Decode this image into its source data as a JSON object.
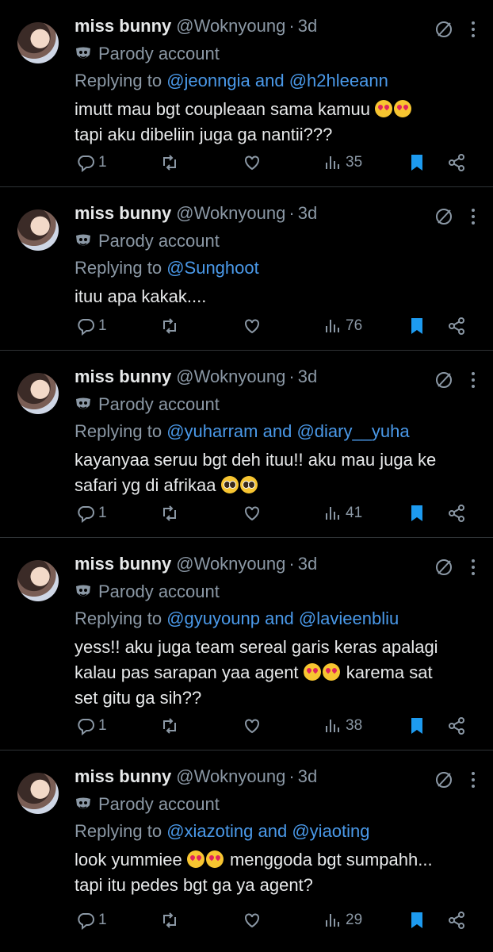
{
  "author": {
    "name": "miss bunny",
    "handle": "@Woknyoung",
    "time": "3d",
    "badge": "Parody account",
    "reply_prefix": "Replying to"
  },
  "tweets": [
    {
      "mention1": "@jeonngia",
      "joiner": "and",
      "mention2": "@h2hleeann",
      "line1": "imutt mau bgt coupleaan sama kamuu",
      "line2": "tapi aku dibeliin juga ga nantii???",
      "replies": "1",
      "views": "35"
    },
    {
      "mention1": "@Sunghoot",
      "joiner": "",
      "mention2": "",
      "line1": "ituu apa kakak....",
      "line2": "",
      "replies": "1",
      "views": "76"
    },
    {
      "mention1": "@yuharram",
      "joiner": "and",
      "mention2": "@diary__yuha",
      "line1": "kayanyaa seruu bgt deh ituu!! aku mau juga ke",
      "line2": "safari yg di afrikaa",
      "replies": "1",
      "views": "41"
    },
    {
      "mention1": "@gyuyounp",
      "joiner": "and",
      "mention2": "@lavieenbliu",
      "line1": "yess!! aku juga team sereal garis keras apalagi",
      "line2": "kalau pas sarapan yaa agent",
      "line2b": "karema sat",
      "line3": "set gitu ga sih??",
      "replies": "1",
      "views": "38"
    },
    {
      "mention1": "@xiazoting",
      "joiner": "and",
      "mention2": "@yiaoting",
      "line1": "look yummiee",
      "line1b": "menggoda bgt sumpahh...",
      "line2": "tapi itu pedes bgt ga ya agent?",
      "replies": "1",
      "views": "29"
    }
  ],
  "icons": [
    "avatar",
    "no-sign-icon",
    "more-icon",
    "parody-mask-icon",
    "reply-icon",
    "retweet-icon",
    "like-icon",
    "views-icon",
    "bookmark-icon",
    "share-icon",
    "heart-eyes-emoji",
    "pleading-face-emoji"
  ],
  "colors": {
    "background": "#000000",
    "text": "#e7e9ea",
    "muted": "#8b98a5",
    "link": "#4a99e9",
    "bookmark": "#1d9bf0"
  }
}
